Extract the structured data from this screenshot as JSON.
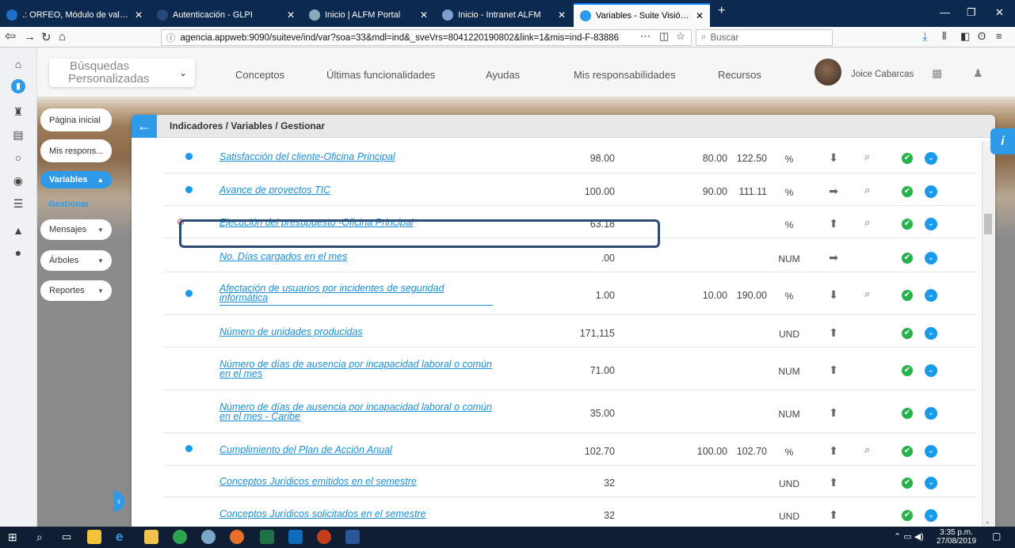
{
  "browser": {
    "tabs": [
      {
        "label": ".: ORFEO, Módulo de validació",
        "color": "#3aa0ff"
      },
      {
        "label": "Autenticación - GLPI",
        "color": ""
      },
      {
        "label": "Inicio | ALFM Portal",
        "color": "#9aa"
      },
      {
        "label": "Inicio - Intranet ALFM",
        "color": "#7a9fd1"
      },
      {
        "label": "Variables - Suite Visión Empres",
        "color": "#3aa0ff"
      }
    ],
    "new_tab": "+",
    "url": "agencia.appweb:9090/suiteve/ind/var?soa=33&mdl=ind&_sveVrs=8041220190802&link=1&mis=ind-F-83886",
    "search_placeholder": "Buscar"
  },
  "header": {
    "search_select_line1": "Búsquedas",
    "search_select_line2": "Personalizadas",
    "menu": [
      "Conceptos",
      "Últimas funcionalidades",
      "Ayudas",
      "Mis responsabilidades",
      "Recursos"
    ],
    "user_name": "Joice Cabarcas"
  },
  "sidebar": {
    "items": [
      {
        "label": "Página inicial"
      },
      {
        "label": "Mis respons..."
      },
      {
        "label": "Variables"
      },
      {
        "label": "Gestionar"
      },
      {
        "label": "Mensajes"
      },
      {
        "label": "Árboles"
      },
      {
        "label": "Reportes"
      }
    ]
  },
  "panel": {
    "breadcrumb": "Indicadores / Variables / Gestionar"
  },
  "table": {
    "rows": [
      {
        "name": "Satisfacción del cliente-Oficina Principal",
        "value": "98.00",
        "goal": "80.00",
        "pct": "122.50",
        "unit": "%",
        "trend": "down"
      },
      {
        "name": "Avance de proyectos TIC",
        "value": "100.00",
        "goal": "90.00",
        "pct": "111.11",
        "unit": "%",
        "trend": "right"
      },
      {
        "name": "Ejecución del presupuesto -Oficina Principal",
        "value": "63.18",
        "goal": "",
        "pct": "",
        "unit": "%",
        "trend": "up"
      },
      {
        "name": "No. Días cargados en el mes",
        "value": ".00",
        "goal": "",
        "pct": "",
        "unit": "NUM",
        "trend": "right"
      },
      {
        "name": "Afectación de usuarios por incidentes de seguridad informática",
        "value": "1.00",
        "goal": "10.00",
        "pct": "190.00",
        "unit": "%",
        "trend": "down"
      },
      {
        "name": "Número de unidades producidas",
        "value": "171,115",
        "goal": "",
        "pct": "",
        "unit": "UND",
        "trend": "up"
      },
      {
        "name": "Número de días de ausencia por incapacidad laboral o común en el mes",
        "value": "71.00",
        "goal": "",
        "pct": "",
        "unit": "NUM",
        "trend": "up"
      },
      {
        "name": "Número de días de ausencia por incapacidad laboral o común en el mes - Caribe",
        "value": "35.00",
        "goal": "",
        "pct": "",
        "unit": "NUM",
        "trend": "up"
      },
      {
        "name": "Cumplimiento del Plan de Acción Anual",
        "value": "102.70",
        "goal": "100.00",
        "pct": "102.70",
        "unit": "%",
        "trend": "up"
      },
      {
        "name": "Conceptos Jurídicos emitidos en el semestre",
        "value": "32",
        "goal": "",
        "pct": "",
        "unit": "UND",
        "trend": "up"
      },
      {
        "name": "Conceptos Jurídicos solicitados en el semestre",
        "value": "32",
        "goal": "",
        "pct": "",
        "unit": "UND",
        "trend": "up"
      }
    ]
  },
  "taskbar": {
    "time": "3:35 p.m.",
    "date": "27/08/2019"
  },
  "colors": {
    "accent": "#2f9be8",
    "ok": "#26b24b",
    "link": "#1a8fd6"
  }
}
